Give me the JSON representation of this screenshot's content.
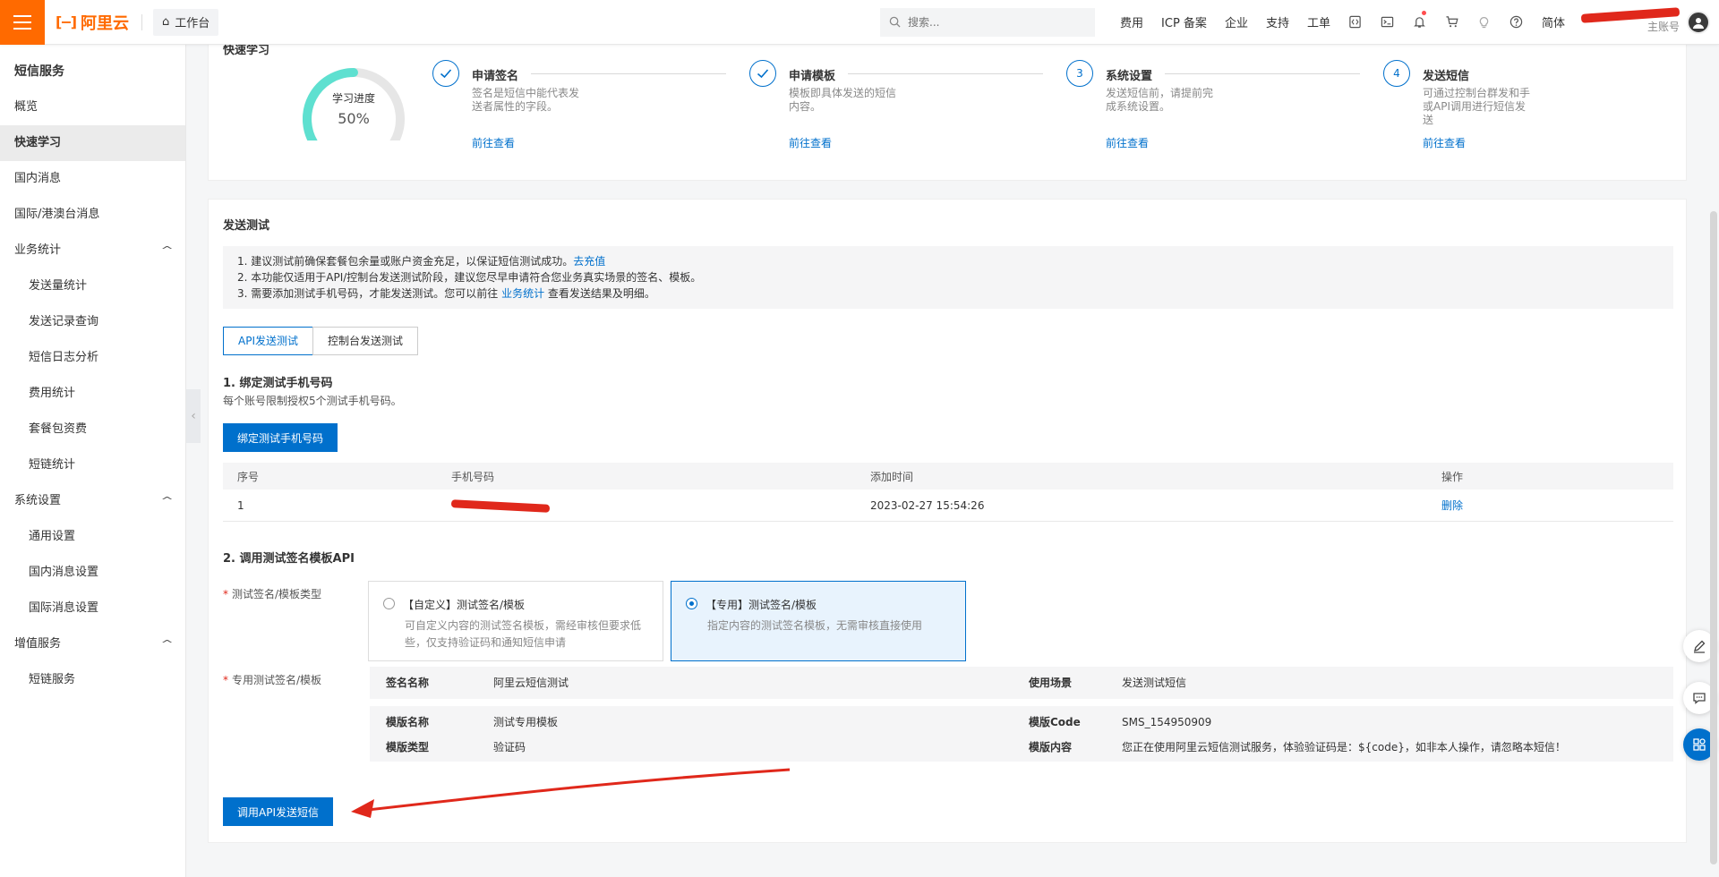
{
  "topbar": {
    "logo_text": "阿里云",
    "workbench": "工作台",
    "search_placeholder": "搜索...",
    "links": [
      "费用",
      "ICP 备案",
      "企业",
      "支持",
      "工单"
    ],
    "lang": "简体",
    "account_sub": "主账号"
  },
  "sidebar": {
    "title": "短信服务",
    "items": [
      {
        "label": "概览"
      },
      {
        "label": "快速学习",
        "active": true
      },
      {
        "label": "国内消息"
      },
      {
        "label": "国际/港澳台消息"
      }
    ],
    "groups": [
      {
        "label": "业务统计",
        "items": [
          "发送量统计",
          "发送记录查询",
          "短信日志分析",
          "费用统计",
          "套餐包资费",
          "短链统计"
        ]
      },
      {
        "label": "系统设置",
        "items": [
          "通用设置",
          "国内消息设置",
          "国际消息设置"
        ]
      },
      {
        "label": "增值服务",
        "items": [
          "短链服务"
        ]
      }
    ]
  },
  "learn": {
    "title": "快速学习",
    "progress_label": "学习进度",
    "progress_value": "50%",
    "progress_fraction": 0.5,
    "steps": [
      {
        "index": "1",
        "done": true,
        "name": "申请签名",
        "desc": "签名是短信中能代表发送者属性的字段。",
        "link": "前往查看"
      },
      {
        "index": "2",
        "done": true,
        "name": "申请模板",
        "desc": "模板即具体发送的短信内容。",
        "link": "前往查看"
      },
      {
        "index": "3",
        "done": false,
        "name": "系统设置",
        "desc": "发送短信前，请提前完成系统设置。",
        "link": "前往查看"
      },
      {
        "index": "4",
        "done": false,
        "name": "发送短信",
        "desc": "可通过控制台群发和手或API调用进行短信发送",
        "link": "前往查看"
      }
    ]
  },
  "test": {
    "title": "发送测试",
    "notice": {
      "line1": "1. 建议测试前确保套餐包余量或账户资金充足，以保证短信测试成功。",
      "line1_link": "去充值",
      "line2": "2. 本功能仅适用于API/控制台发送测试阶段，建议您尽早申请符合您业务真实场景的签名、模板。",
      "line3_pre": "3. 需要添加测试手机号码，才能发送测试。您可以前往 ",
      "line3_link": "业务统计",
      "line3_post": " 查看发送结果及明细。"
    },
    "tabs": [
      "API发送测试",
      "控制台发送测试"
    ],
    "bind": {
      "title": "1. 绑定测试手机号码",
      "desc": "每个账号限制授权5个测试手机号码。",
      "button": "绑定测试手机号码"
    },
    "table": {
      "headers": [
        "序号",
        "手机号码",
        "添加时间",
        "操作"
      ],
      "rows": [
        {
          "index": "1",
          "time": "2023-02-27 15:54:26",
          "action": "删除"
        }
      ]
    },
    "api": {
      "title": "2. 调用测试签名模板API",
      "type_label": "测试签名/模板类型",
      "options": [
        {
          "title": "【自定义】测试签名/模板",
          "desc": "可自定义内容的测试签名模板，需经审核但要求低些，仅支持验证码和通知短信申请",
          "selected": false
        },
        {
          "title": "【专用】测试签名/模板",
          "desc": "指定内容的测试签名模板，无需审核直接使用",
          "selected": true
        }
      ],
      "dedicated_label": "专用测试签名/模板",
      "sign_name_k": "签名名称",
      "sign_name_v": "阿里云短信测试",
      "scene_k": "使用场景",
      "scene_v": "发送测试短信",
      "tpl_name_k": "模版名称",
      "tpl_name_v": "测试专用模板",
      "tpl_code_k": "模版Code",
      "tpl_code_v": "SMS_154950909",
      "tpl_type_k": "模版类型",
      "tpl_type_v": "验证码",
      "tpl_content_k": "模版内容",
      "tpl_content_v": "您正在使用阿里云短信测试服务，体验验证码是：${code}，如非本人操作，请忽略本短信！",
      "call_button": "调用API发送短信"
    }
  },
  "colors": {
    "brand": "#ff6a00",
    "primary": "#0070cc",
    "arrow": "#e0281b",
    "gauge": "#5ee0d0"
  }
}
